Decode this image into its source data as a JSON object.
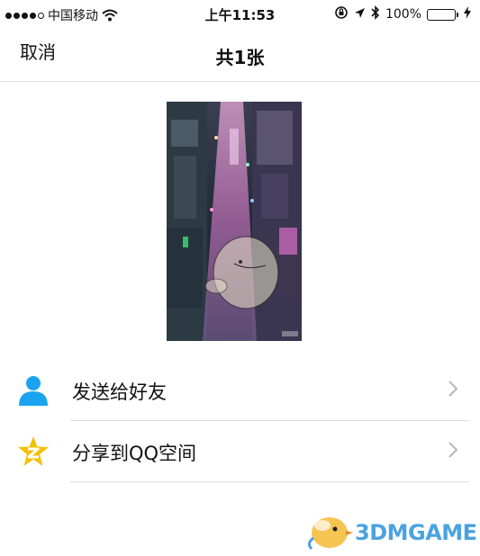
{
  "status_bar": {
    "carrier": "中国移动",
    "time": "上午11:53",
    "battery_percent": "100%",
    "battery_level": 1.0,
    "icons": [
      "signal-dots-icon",
      "wifi-icon",
      "rotation-lock-icon",
      "location-arrow-icon",
      "bluetooth-icon",
      "battery-icon",
      "charging-bolt-icon"
    ]
  },
  "nav": {
    "cancel_label": "取消",
    "title": "共1张"
  },
  "share_options": [
    {
      "label": "发送给好友",
      "icon": "person-icon",
      "color": "#1aa4f0"
    },
    {
      "label": "分享到QQ空间",
      "icon": "qzone-star-icon",
      "color": "#f5c000"
    }
  ],
  "watermark": {
    "text": "3DMGAME"
  },
  "colors": {
    "accent_blue": "#1aa4f0",
    "qzone_yellow": "#f5c000",
    "battery_green": "#4cd964",
    "watermark_blue": "#4aa3e0"
  }
}
